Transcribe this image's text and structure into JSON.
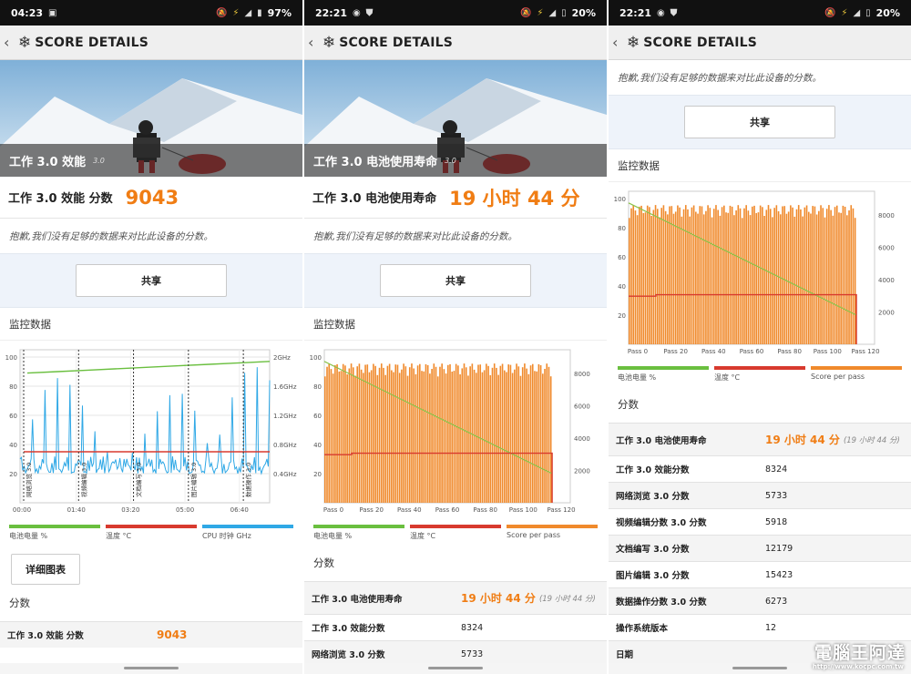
{
  "app_title": "SCORE DETAILS",
  "panels": [
    {
      "status": {
        "time": "04:23",
        "battery": "97%"
      },
      "hero_label": "工作 3.0 效能",
      "hero_version": "3.0",
      "score_label": "工作 3.0 效能 分数",
      "score_value": "9043",
      "notice": "抱歉,我们没有足够的数据来对比此设备的分数。",
      "share_label": "共享",
      "monitor_title": "监控数据",
      "legend": [
        "电池电量 %",
        "温度 °C",
        "CPU 时钟 GHz"
      ],
      "detail_button": "详细图表",
      "scores_title": "分数",
      "scores": [
        {
          "label": "工作 3.0 效能 分数",
          "value": "9043"
        }
      ]
    },
    {
      "status": {
        "time": "22:21",
        "battery": "20%"
      },
      "hero_label": "工作 3.0 电池使用寿命",
      "hero_version": "3.0",
      "score_label": "工作 3.0 电池使用寿命",
      "score_value": "19 小时 44 分",
      "notice": "抱歉,我们没有足够的数据来对比此设备的分数。",
      "share_label": "共享",
      "monitor_title": "监控数据",
      "legend": [
        "电池电量 %",
        "温度 °C",
        "Score per pass"
      ],
      "scores_title": "分数",
      "scores": [
        {
          "label": "工作 3.0 电池使用寿命",
          "value": "19 小时 44 分",
          "sub": "(19 小时 44 分)"
        },
        {
          "label": "工作 3.0 效能分数",
          "value": "8324"
        },
        {
          "label": "网络浏览 3.0 分数",
          "value": "5733"
        }
      ]
    },
    {
      "status": {
        "time": "22:21",
        "battery": "20%"
      },
      "notice": "抱歉,我们没有足够的数据来对比此设备的分数。",
      "share_label": "共享",
      "monitor_title": "监控数据",
      "legend": [
        "电池电量 %",
        "温度 °C",
        "Score per pass"
      ],
      "scores_title": "分数",
      "scores": [
        {
          "label": "工作 3.0 电池使用寿命",
          "value": "19 小时 44 分",
          "sub": "(19 小时 44 分)"
        },
        {
          "label": "工作 3.0 效能分数",
          "value": "8324"
        },
        {
          "label": "网络浏览 3.0 分数",
          "value": "5733"
        },
        {
          "label": "视频编辑分数 3.0 分数",
          "value": "5918"
        },
        {
          "label": "文档编写 3.0 分数",
          "value": "12179"
        },
        {
          "label": "图片编辑 3.0 分数",
          "value": "15423"
        },
        {
          "label": "数据操作分数 3.0 分数",
          "value": "6273"
        },
        {
          "label": "操作系统版本",
          "value": "12"
        },
        {
          "label": "日期",
          "value": ""
        }
      ]
    }
  ],
  "perf_chart": {
    "type": "line",
    "y_left_ticks": [
      "100",
      "80",
      "60",
      "40",
      "20"
    ],
    "y_right_ticks": [
      "2GHz",
      "1.6GHz",
      "1.2GHz",
      "0.8GHz",
      "0.4GHz"
    ],
    "x_ticks": [
      "00:00",
      "01:40",
      "03:20",
      "05:00",
      "06:40"
    ],
    "segments": [
      "网络浏览 3.0",
      "视频编辑 3.0",
      "文档编写 3.0",
      "图片编辑 3.0",
      "数据操作 3.0"
    ],
    "battery": [
      89,
      90,
      91,
      92,
      93,
      94,
      95,
      96,
      97
    ],
    "temperature": 35,
    "colors": {
      "battery": "#6abf3f",
      "temperature": "#d83a2e",
      "cpu": "#2fa8e6"
    }
  },
  "battery_chart": {
    "type": "bar",
    "y_left_ticks": [
      "100",
      "80",
      "60",
      "40",
      "20"
    ],
    "y_right_ticks": [
      "8000",
      "6000",
      "4000",
      "2000"
    ],
    "x_ticks": [
      "Pass 0",
      "Pass 20",
      "Pass 40",
      "Pass 60",
      "Pass 80",
      "Pass 100",
      "Pass 120"
    ],
    "passes": 122,
    "score_range": [
      7800,
      8600
    ],
    "battery_start": 97,
    "battery_end": 20,
    "temperature": 33,
    "colors": {
      "bar": "#f08a2c",
      "battery": "#8bc34a",
      "temperature": "#d83a2e"
    }
  },
  "watermark": {
    "main": "電腦王阿達",
    "sub": "http://www.kocpc.com.tw"
  }
}
